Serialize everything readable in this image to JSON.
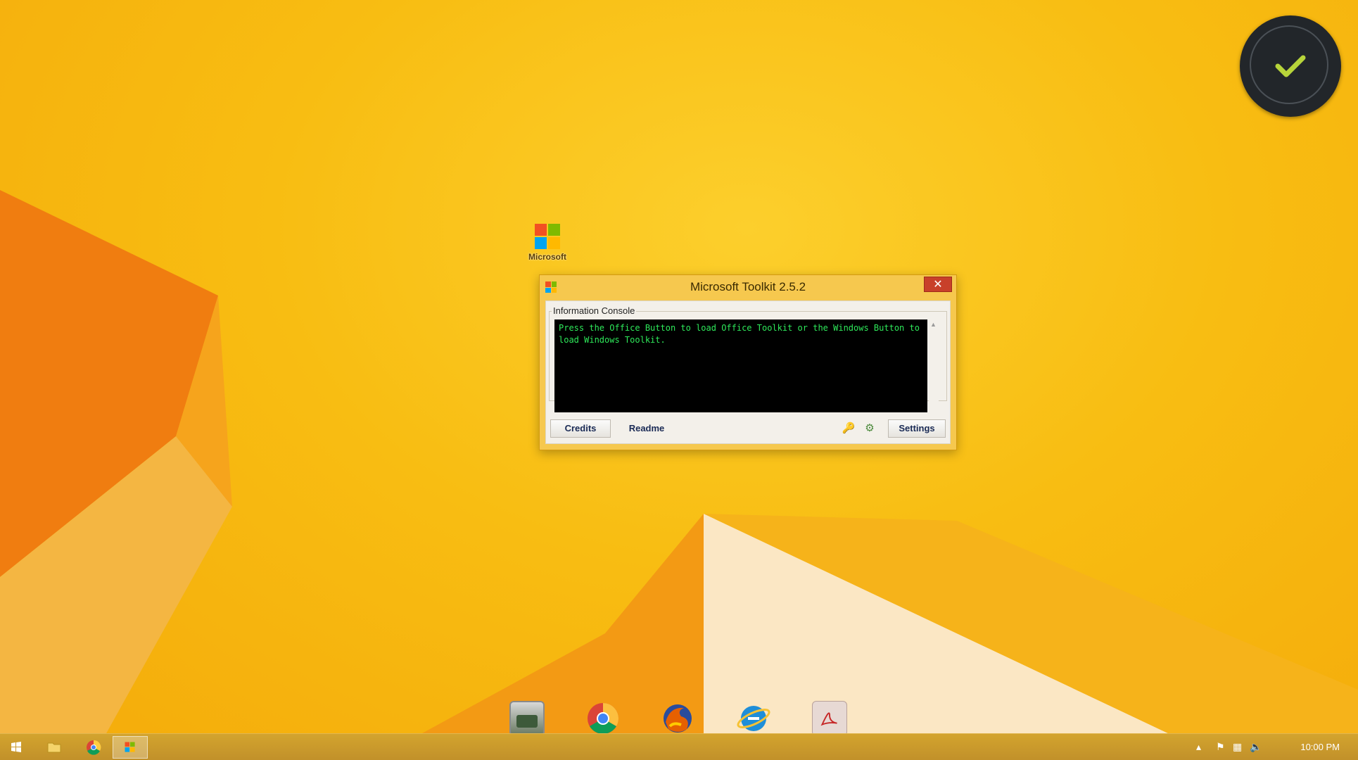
{
  "desktop": {
    "icon": {
      "label": "Microsoft",
      "icon": "microsoft-logo"
    }
  },
  "gadget": {
    "icon": "check-icon",
    "accent": "#b7d43a"
  },
  "dialog": {
    "title": "Microsoft Toolkit 2.5.2",
    "close_label": "✕",
    "console_label": "Information Console",
    "console_text": "Press the Office Button to load Office Toolkit or the Windows Button to load Windows Toolkit.",
    "buttons": {
      "credits": "Credits",
      "readme": "Readme",
      "settings": "Settings"
    },
    "tools": {
      "key": "🔑",
      "gear": "⚙"
    }
  },
  "dock": {
    "items": [
      "app-icon",
      "chrome-icon",
      "firefox-icon",
      "internet-explorer-icon",
      "pdf-icon"
    ]
  },
  "taskbar": {
    "items": [
      "start-icon",
      "file-explorer-icon",
      "chrome-icon",
      "microsoft-toolkit-icon"
    ],
    "clock": "10:00 PM"
  },
  "colors": {
    "wallpaper": "#f8bd12",
    "console_text": "#2ee85a",
    "close_button": "#c8402a",
    "taskbar": "#c99a2c"
  }
}
